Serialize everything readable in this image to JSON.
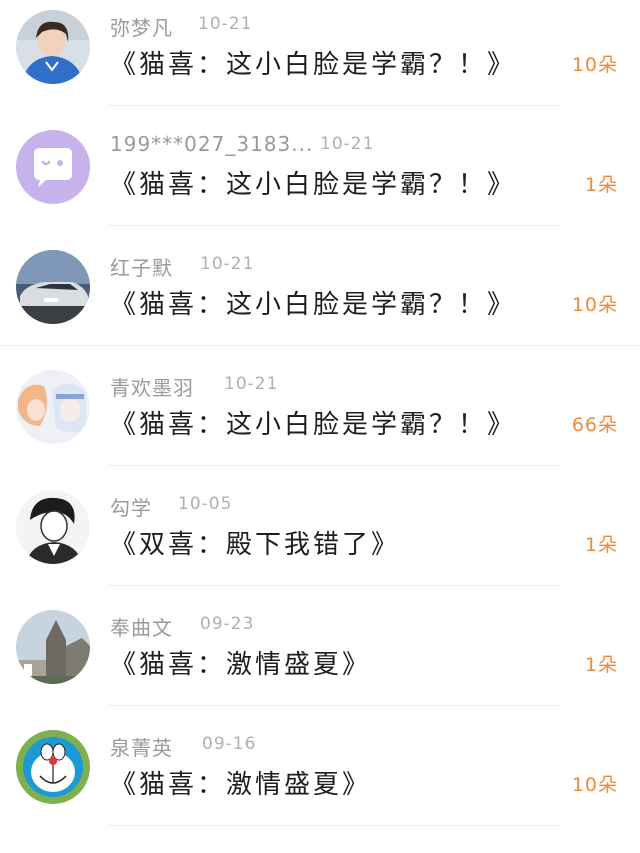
{
  "records": [
    {
      "user": "弥梦凡",
      "date": "10-21",
      "title": "《猫喜：这小白脸是学霸？！》",
      "gift": "10朵",
      "avatar_icon": "girl-blue-jacket-avatar"
    },
    {
      "user": "199***027_3183...",
      "date": "10-21",
      "title": "《猫喜：这小白脸是学霸？！》",
      "gift": "1朵",
      "avatar_icon": "chat-bubble-wink-avatar"
    },
    {
      "user": "红子默",
      "date": "10-21",
      "title": "《猫喜：这小白脸是学霸？！》",
      "gift": "10朵",
      "avatar_icon": "car-avatar"
    },
    {
      "user": "青欢墨羽",
      "date": "10-21",
      "title": "《猫喜：这小白脸是学霸？！》",
      "gift": "66朵",
      "avatar_icon": "anime-pair-avatar"
    },
    {
      "user": "勾学",
      "date": "10-05",
      "title": "《双喜：殿下我错了》",
      "gift": "1朵",
      "avatar_icon": "sketch-man-avatar"
    },
    {
      "user": "奉曲文",
      "date": "09-23",
      "title": "《猫喜：激情盛夏》",
      "gift": "1朵",
      "avatar_icon": "cathedral-avatar"
    },
    {
      "user": "泉菁英",
      "date": "09-16",
      "title": "《猫喜：激情盛夏》",
      "gift": "10朵",
      "avatar_icon": "doraemon-avatar"
    }
  ],
  "colors": {
    "gift": "#f08a3a",
    "name": "#9a9a9a",
    "title": "#1e1e1e"
  }
}
